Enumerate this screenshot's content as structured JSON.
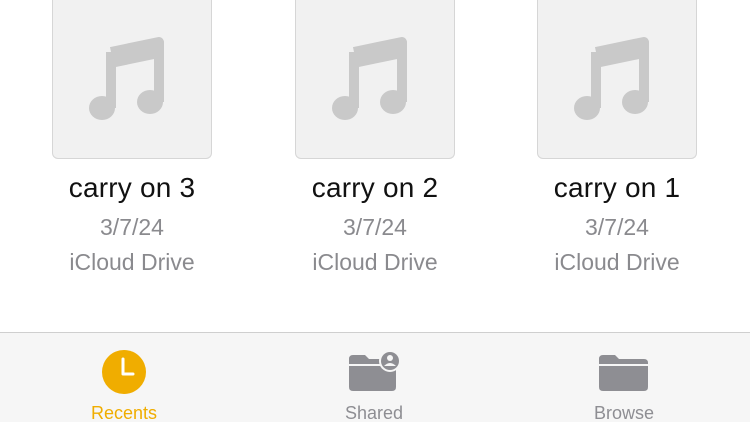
{
  "files": [
    {
      "name": "carry on 3",
      "date": "3/7/24",
      "location": "iCloud Drive",
      "icon": "music-note-icon"
    },
    {
      "name": "carry on 2",
      "date": "3/7/24",
      "location": "iCloud Drive",
      "icon": "music-note-icon"
    },
    {
      "name": "carry on 1",
      "date": "3/7/24",
      "location": "iCloud Drive",
      "icon": "music-note-icon"
    }
  ],
  "tab_bar": {
    "tabs": [
      {
        "label": "Recents",
        "icon": "clock-icon",
        "active": true
      },
      {
        "label": "Shared",
        "icon": "shared-folder-icon",
        "active": false
      },
      {
        "label": "Browse",
        "icon": "folder-icon",
        "active": false
      }
    ]
  },
  "colors": {
    "accent": "#f0ad00",
    "inactive": "#8e8e93",
    "thumbnail_bg": "#f1f1f1",
    "music_glyph": "#c9c9c9"
  }
}
